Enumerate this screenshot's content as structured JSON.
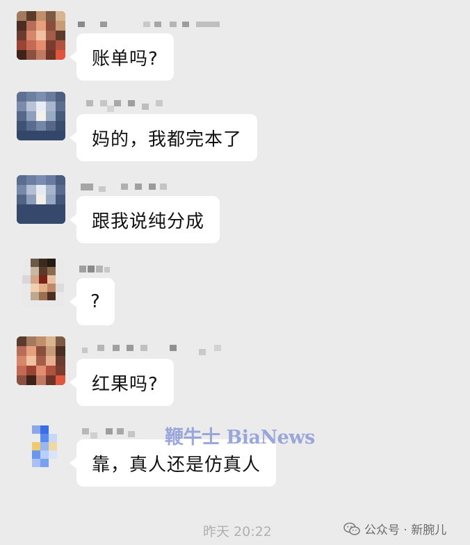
{
  "messages": [
    {
      "text": "账单吗?"
    },
    {
      "text": "妈的，我都完本了"
    },
    {
      "text": "跟我说纯分成"
    },
    {
      "text": "?"
    },
    {
      "text": "红果吗?"
    },
    {
      "text": "靠，真人还是仿真人"
    }
  ],
  "timestamp": "昨天 20:22",
  "watermark": "鞭牛士 BiaNews",
  "source_tag": "公众号 · 新腕儿",
  "icons": {
    "source_icon": "wechat-icon"
  }
}
